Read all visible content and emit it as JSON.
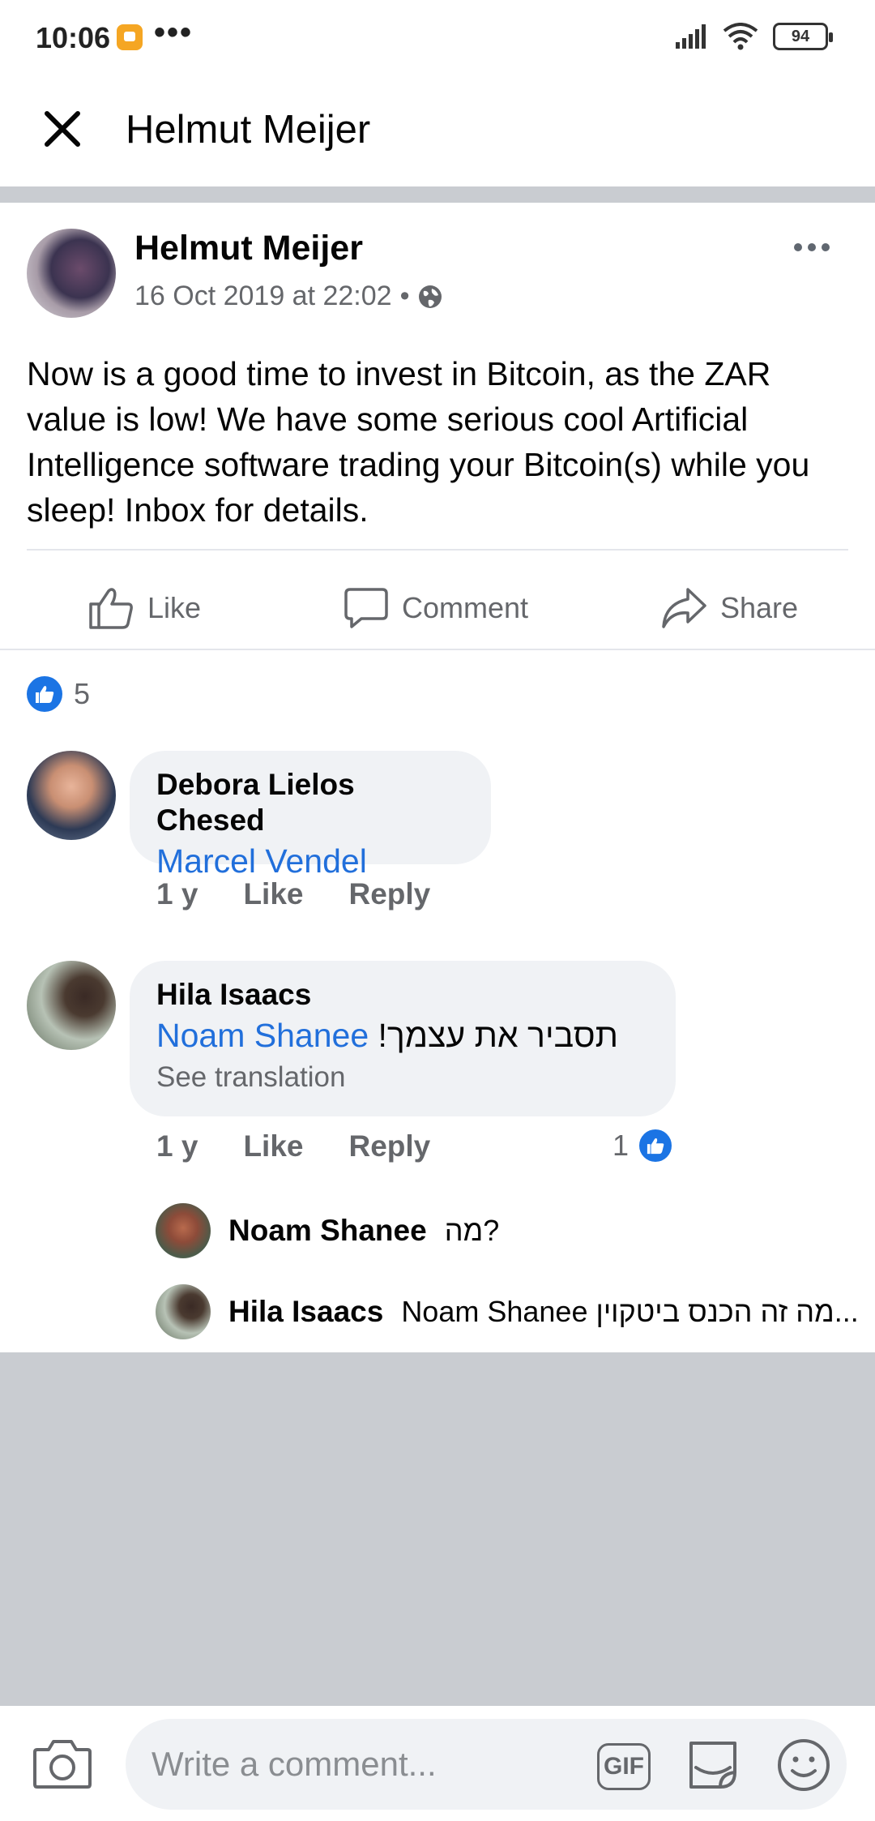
{
  "status": {
    "time": "10:06",
    "more": "•••",
    "battery": "94"
  },
  "header": {
    "title": "Helmut Meijer"
  },
  "post": {
    "author": "Helmut Meijer",
    "date": "16 Oct 2019 at 22:02",
    "separator": "•",
    "text": "Now is a good time to invest in Bitcoin, as the ZAR value is low! We have some serious cool Artificial Intelligence software trading your Bitcoin(s) while you sleep! Inbox for details.",
    "actions": {
      "like": "Like",
      "comment": "Comment",
      "share": "Share"
    }
  },
  "reactions": {
    "count": "5"
  },
  "comments": [
    {
      "author": "Debora Lielos Chesed",
      "mention": "Marcel Vendel",
      "text": "",
      "time": "1 y",
      "like": "Like",
      "reply": "Reply"
    },
    {
      "author": "Hila Isaacs",
      "mention": "Noam Shanee",
      "text": "תסביר את עצמך!",
      "translate": "See translation",
      "time": "1 y",
      "like": "Like",
      "reply": "Reply",
      "reaction_count": "1"
    }
  ],
  "replies": [
    {
      "author": "Noam Shanee",
      "text": "מה?"
    },
    {
      "author": "Hila Isaacs",
      "text": "Noam Shanee מה זה הכנס ביטקוין..."
    }
  ],
  "composer": {
    "placeholder": "Write a comment...",
    "gif": "GIF"
  }
}
